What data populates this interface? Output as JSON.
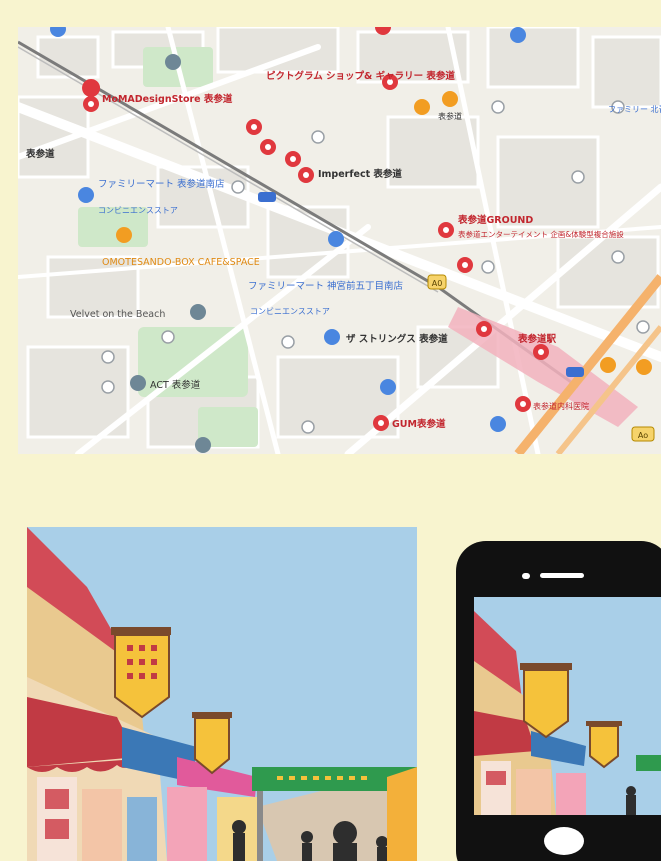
{
  "map": {
    "labels": {
      "myriad": "MoMADesignStore 表参道",
      "pictogram": "ピクトグラム ショップ& ギャラリー 表参道",
      "imperfect": "Imperfect 表参道",
      "omotesando_ground": "表参道GROUND",
      "omotesando_ground_sub": "表参道エンターテイメント 企画&体験型複合施設",
      "famima_left": "ファミリーマート 表参道南店",
      "famima_left_sub": "コンビニエンスストア",
      "omotesando_box": "OMOTESANDO-BOX CAFE&SPACE",
      "famima_center": "ファミリーマート 神宮前五丁目南店",
      "famima_center_sub": "コンビニエンスストア",
      "velvet": "Velvet on the Beach",
      "strings": "ザ ストリングス 表参道",
      "station": "表参道駅",
      "act": "ACT 表参道",
      "gum": "GUM表参道",
      "station_sub": "表参道内科医院",
      "famima_right": "ファミリー 北青山 コンビニエ",
      "ao": "Ao",
      "route": "A0",
      "small1": "表参道",
      "small2": "表参道"
    },
    "colors": {
      "red_pin": "#e0383e",
      "orange_pin": "#f29d22",
      "blue_pin": "#4a86e0",
      "gray_pin": "#6e8796",
      "rail": "#f0a9b4",
      "park": "#c9e6c5",
      "road": "#ffffff",
      "block": "#eceae4"
    }
  },
  "street": {
    "colors": {
      "sky": "#a7cfe6",
      "awning_red": "#c63b45",
      "awning_blue": "#3f78b5",
      "sign_yellow": "#f5c23b",
      "banner_green": "#2f9a4e"
    }
  },
  "phone": {
    "icon_name": "smartphone-icon",
    "colors": {
      "body": "#111111",
      "screen_sky": "#a7cfe6"
    }
  }
}
